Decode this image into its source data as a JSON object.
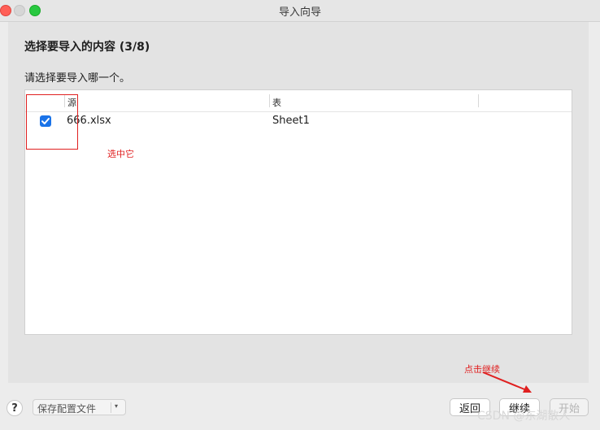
{
  "window": {
    "title": "导入向导"
  },
  "step": {
    "heading": "选择要导入的内容 (3/8)",
    "instruction": "请选择要导入哪一个。"
  },
  "table": {
    "columns": [
      "源",
      "表"
    ],
    "rows": [
      {
        "checked": true,
        "source": "666.xlsx",
        "sheet": "Sheet1"
      }
    ]
  },
  "annotations": {
    "select_note": "选中它",
    "continue_note": "点击继续",
    "color": "#e02020"
  },
  "footer": {
    "help_label": "?",
    "preset_label": "保存配置文件",
    "preset_arrow": "▾",
    "back_label": "返回",
    "continue_label": "继续",
    "start_label": "开始"
  },
  "watermark": "CSDN @东湖散人",
  "colors": {
    "accent": "#1a73e8",
    "annotation": "#e02020",
    "close": "#ff5f57",
    "maximize": "#28c840"
  }
}
